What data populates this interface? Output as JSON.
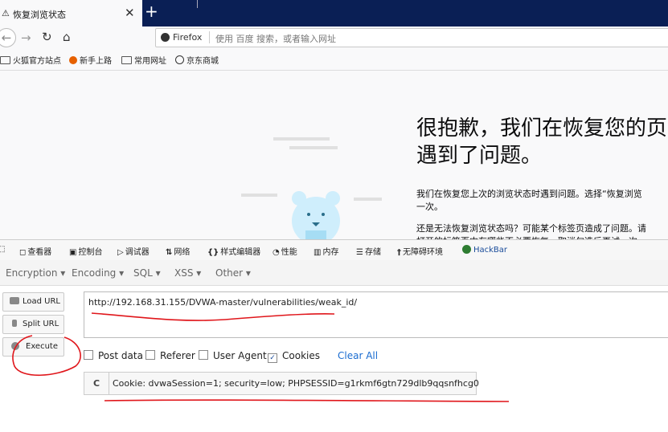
{
  "tab": {
    "title": "恢复浏览状态",
    "close": "✕",
    "new": "+",
    "warn": "⚠"
  },
  "nav": {
    "back": "←",
    "forward": "→",
    "reload": "↻",
    "home": "⌂"
  },
  "urlbar": {
    "brand": "Firefox",
    "placeholder": "使用 百度 搜索，或者输入网址"
  },
  "bookmarks": [
    "火狐官方站点",
    "新手上路",
    "常用网址",
    "京东商城"
  ],
  "error": {
    "title": "很抱歉，我们在恢复您的页\n遇到了问题。",
    "p1": "我们在恢复您上次的浏览状态时遇到问题。选择“恢复浏览\n一次。",
    "p2": "还是无法恢复浏览状态吗？可能某个标签页造成了问题。请\n打开的标签页中有哪些不必要恢复，取消勾选后再试一次"
  },
  "devtools": {
    "inspector": "查看器",
    "console": "控制台",
    "debugger": "调试器",
    "network": "网络",
    "style": "样式编辑器",
    "performance": "性能",
    "memory": "内存",
    "storage": "存储",
    "a11y": "无障碍环境",
    "hackbar": "HackBar"
  },
  "hackbar": {
    "menu": [
      "Encryption ▾",
      "Encoding ▾",
      "SQL ▾",
      "XSS ▾",
      "Other ▾"
    ],
    "load_url": "Load URL",
    "split_url": "Split URL",
    "execute": "Execute",
    "url": "http://192.168.31.155/DVWA-master/vulnerabilities/weak_id/",
    "post_data": "Post data",
    "referer": "Referer",
    "user_agent": "User Agent",
    "cookies": "Cookies",
    "cookies_checked": true,
    "clear_all": "Clear All",
    "cookie_label": "C",
    "cookie_value": "Cookie: dvwaSession=1; security=low; PHPSESSID=g1rkmf6gtn729dlb9qqsnfhcg0"
  },
  "colors": {
    "annotation": "#e0161b",
    "tabstrip": "#0a1f55",
    "link": "#1a6cd0"
  }
}
